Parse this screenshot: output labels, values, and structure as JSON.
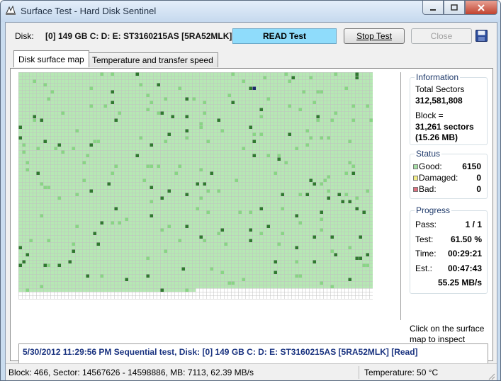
{
  "window": {
    "title": "Surface Test - Hard Disk Sentinel"
  },
  "header": {
    "disk_label": "Disk:",
    "disk_value": "[0] 149 GB C: D: E: ST3160215AS [5RA52MLK]",
    "mode": "READ Test",
    "stop_button": "Stop Test",
    "close_button": "Close"
  },
  "tabs": [
    "Disk surface map",
    "Temperature and transfer speed"
  ],
  "information": {
    "title": "Information",
    "total_label": "Total Sectors",
    "total_value": "312,581,808",
    "block_label": "Block =",
    "block_value": "31,261 sectors",
    "block_size": "(15.26 MB)"
  },
  "status": {
    "title": "Status",
    "good_label": "Good:",
    "good_value": "6150",
    "damaged_label": "Damaged:",
    "damaged_value": "0",
    "bad_label": "Bad:",
    "bad_value": "0"
  },
  "progress": {
    "title": "Progress",
    "pass_label": "Pass:",
    "pass_value": "1 / 1",
    "test_label": "Test:",
    "test_value": "61.50 %",
    "time_label": "Time:",
    "time_value": "00:29:21",
    "est_label": "Est.:",
    "est_value": "00:47:43",
    "speed": "55.25 MB/s"
  },
  "hint": "Click on the surface map to inspect",
  "log": [
    "5/30/2012  11:29:56 PM   Sequential test, Disk: [0] 149 GB C: D: E: ST3160215AS [5RA52MLK] [Read]"
  ],
  "statusbar": {
    "left": "Block: 466, Sector: 14567626 - 14598886, MB: 7113, 62.39 MB/s",
    "right": "Temperature: 50  °C"
  },
  "surface_map": {
    "columns": 100,
    "rows": 64,
    "tested_blocks": 6150,
    "colors": {
      "good": "#b6e8b4",
      "good_alt": "#88d684",
      "good_dark": "#2f7a2f",
      "untested": "#ffffff",
      "grid": "#c0c0c0",
      "current": "#1a2a6a"
    },
    "current_block": 466
  },
  "colors": {
    "legend_good": "#a8e0a8",
    "legend_damaged": "#f4ee88",
    "legend_bad": "#e07080"
  }
}
